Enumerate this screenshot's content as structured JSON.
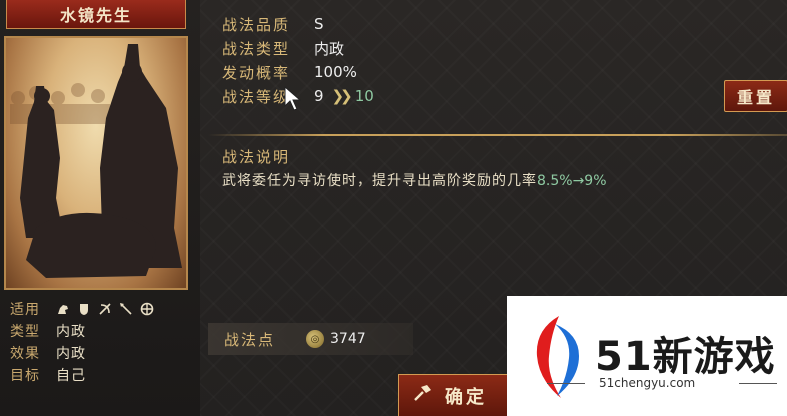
{
  "general": {
    "name": "水镜先生",
    "info": [
      {
        "label": "适用",
        "value": ""
      },
      {
        "label": "类型",
        "value": "内政"
      },
      {
        "label": "效果",
        "value": "内政"
      },
      {
        "label": "目标",
        "value": "自己"
      }
    ],
    "unit_icons": [
      "cavalry-icon",
      "shield-icon",
      "bow-icon",
      "spear-icon",
      "siege-icon"
    ]
  },
  "skill": {
    "stats": [
      {
        "label": "战法品质",
        "value": "S"
      },
      {
        "label": "战法类型",
        "value": "内政"
      },
      {
        "label": "发动概率",
        "value": "100%"
      },
      {
        "label": "战法等级",
        "value": "9"
      }
    ],
    "level_next": "10",
    "reset_label": "重置",
    "desc_title": "战法说明",
    "desc_text": "武将委任为寻访使时，提升寻出高阶奖励的几率",
    "desc_highlight": "8.5%→9%"
  },
  "points": {
    "label": "战法点",
    "value": "3747"
  },
  "confirm_label": "确定",
  "watermark": {
    "title": "51新游戏",
    "sub": "51chengyu.com"
  },
  "colors": {
    "accent_gold": "#d8b878",
    "highlight_green": "#8fc9a2",
    "button_red": "#8c2a16"
  }
}
